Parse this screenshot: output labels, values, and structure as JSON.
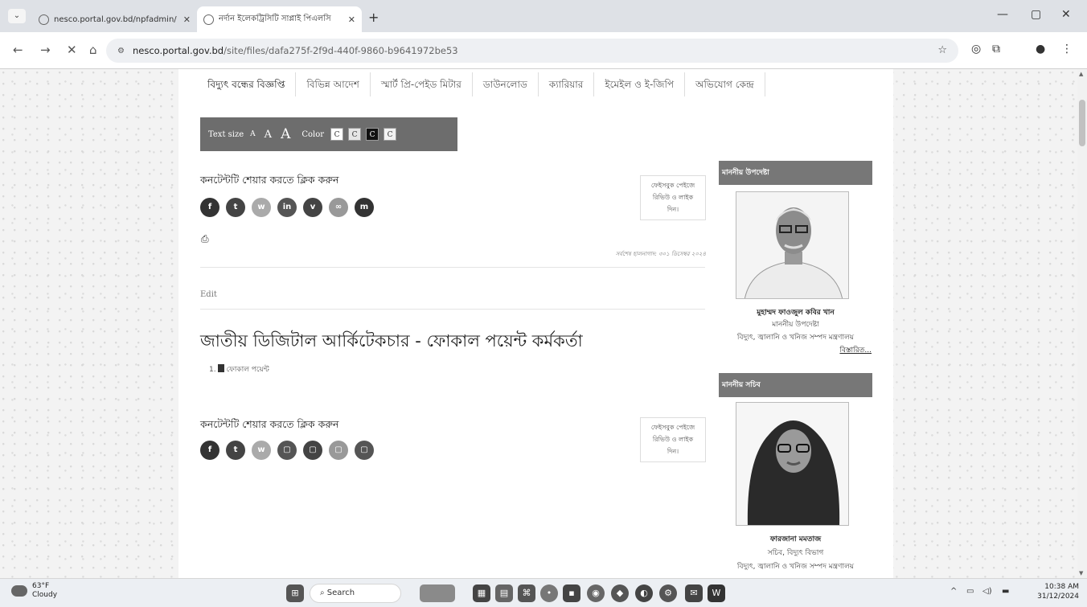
{
  "browser": {
    "tabs": [
      {
        "title": "nesco.portal.gov.bd/npfadmin/",
        "active": false
      },
      {
        "title": "নর্দান ইলেকট্রিসিটি সাপ্লাই পিএলসি",
        "active": true
      }
    ],
    "new_tab": "+",
    "url_host": "nesco.portal.gov.bd",
    "url_path": "/site/files/dafa275f-2f9d-440f-9860-b9641972be53"
  },
  "page": {
    "menu": [
      "বিদ্যুৎ বন্ধের বিজ্ঞপ্তি",
      "বিভিন্ন আদেশ",
      "স্মার্ট প্রি-পেইড মিটার",
      "ডাউনলোড",
      "ক্যারিয়ার",
      "ইমেইল ও ই-জিপি",
      "অভিযোগ কেন্দ্র"
    ],
    "accessibility": {
      "text_size_label": "Text size",
      "size_small": "A",
      "size_medium": "A",
      "size_large": "A",
      "color_label": "Color",
      "swatches": [
        {
          "label": "C",
          "bg": "#ffffff",
          "fg": "#333333"
        },
        {
          "label": "C",
          "bg": "#e6e6e6",
          "fg": "#333333"
        },
        {
          "label": "C",
          "bg": "#111111",
          "fg": "#ffffff"
        },
        {
          "label": "C",
          "bg": "#f2f2f2",
          "fg": "#333333"
        }
      ]
    },
    "share": {
      "title": "কনটেন্টটি শেয়ার করতে ক্লিক করুন",
      "facebook_box": [
        "ফেইসবুক পেইজে",
        "রিভিউ ও লাইক",
        "দিন।"
      ],
      "buttons_top": [
        {
          "icon": "facebook-icon",
          "glyph": "f",
          "color": "#333333"
        },
        {
          "icon": "twitter-icon",
          "glyph": "t",
          "color": "#444444"
        },
        {
          "icon": "whatsapp-icon",
          "glyph": "w",
          "color": "#aaaaaa"
        },
        {
          "icon": "linkedin-icon",
          "glyph": "in",
          "color": "#555555"
        },
        {
          "icon": "viber-icon",
          "glyph": "v",
          "color": "#444444"
        },
        {
          "icon": "link-icon",
          "glyph": "∞",
          "color": "#999999"
        },
        {
          "icon": "messenger-icon",
          "glyph": "m",
          "color": "#333333"
        }
      ],
      "buttons_bottom": [
        {
          "icon": "facebook-icon",
          "glyph": "f",
          "color": "#333333"
        },
        {
          "icon": "twitter-icon",
          "glyph": "t",
          "color": "#444444"
        },
        {
          "icon": "whatsapp-icon",
          "glyph": "w",
          "color": "#aaaaaa"
        },
        {
          "icon": "linkedin-icon",
          "glyph": "▢",
          "color": "#555555"
        },
        {
          "icon": "viber-icon",
          "glyph": "▢",
          "color": "#444444"
        },
        {
          "icon": "link-icon",
          "glyph": "▢",
          "color": "#999999"
        },
        {
          "icon": "messenger-icon",
          "glyph": "▢",
          "color": "#555555"
        }
      ]
    },
    "last_updated": "সর্বশেষ হালনাগাদ: ৩০১ ডিসেম্বর ২০২৪",
    "edit_label": "Edit",
    "main_title": "জাতীয় ডিজিটাল আর্কিটেকচার - ফোকাল পয়েন্ট কর্মকর্তা",
    "attachment_number": "1.",
    "attachment_label": "ফোকাল পয়েন্ট"
  },
  "sidebar": {
    "adviser": {
      "header": "মাননীয় উপদেষ্টা",
      "name": "মুহাম্মদ ফাওজুল কবির খান",
      "role": "মাননীয় উপদেষ্টা",
      "ministry": "বিদ্যুৎ, জ্বালানি ও খনিজ সম্পদ মন্ত্রণালয়",
      "more": "বিস্তারিত..."
    },
    "secretary": {
      "header": "মাননীয় সচিব",
      "name": "ফারজানা মমতাজ",
      "role": "সচিব, বিদ্যুৎ বিভাগ",
      "ministry": "বিদ্যুৎ, জ্বালানি ও খনিজ সম্পদ মন্ত্রণালয়"
    }
  },
  "taskbar": {
    "temperature": "63°F",
    "condition": "Cloudy",
    "search": "Search",
    "time": "10:38 AM",
    "date": "31/12/2024"
  }
}
